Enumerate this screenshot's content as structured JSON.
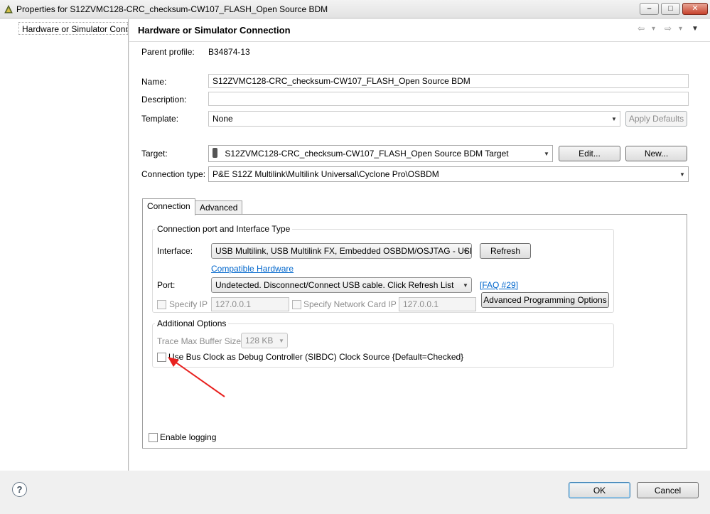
{
  "window": {
    "title": "Properties for S12ZVMC128-CRC_checksum-CW107_FLASH_Open Source BDM",
    "minimize_glyph": "–",
    "maximize_glyph": "□",
    "close_glyph": "✕"
  },
  "sidebar": {
    "items": [
      {
        "label": "Hardware or Simulator Conn"
      }
    ]
  },
  "page": {
    "title": "Hardware or Simulator Connection",
    "nav": {
      "back_glyph": "⇦",
      "back_menu": "▾",
      "forward_glyph": "⇨",
      "forward_menu": "▾",
      "view_menu": "▼"
    },
    "parent_profile_label": "Parent profile:",
    "parent_profile_value": "B34874-13",
    "name_label": "Name:",
    "name_value": "S12ZVMC128-CRC_checksum-CW107_FLASH_Open Source BDM",
    "description_label": "Description:",
    "description_value": "",
    "template_label": "Template:",
    "template_value": "None",
    "apply_defaults_label": "Apply Defaults",
    "target_label": "Target:",
    "target_value": "S12ZVMC128-CRC_checksum-CW107_FLASH_Open Source BDM Target",
    "edit_label": "Edit...",
    "new_label": "New...",
    "connection_type_label": "Connection type:",
    "connection_type_value": "P&E S12Z Multilink\\Multilink Universal\\Cyclone Pro\\OSBDM"
  },
  "tabs": [
    {
      "label": "Connection",
      "active": true
    },
    {
      "label": "Advanced",
      "active": false
    }
  ],
  "connection": {
    "group_title": "Connection port and Interface Type",
    "interface_label": "Interface:",
    "interface_value": "USB Multilink, USB Multilink FX, Embedded OSBDM/OSJTAG - USB",
    "refresh_label": "Refresh",
    "compatible_hardware_link": "Compatible Hardware",
    "port_label": "Port:",
    "port_value": "Undetected. Disconnect/Connect USB cable. Click Refresh List",
    "faq_link": "[FAQ #29]",
    "specify_ip_label": "Specify IP",
    "specify_ip_value": "127.0.0.1",
    "specify_network_card_label": "Specify Network Card IP",
    "network_card_value": "127.0.0.1",
    "advanced_programming_label": "Advanced Programming Options"
  },
  "additional": {
    "group_title": "Additional Options",
    "trace_buffer_label": "Trace Max Buffer Size:",
    "trace_buffer_value": "128 KB",
    "bus_clock_label": "Use Bus Clock as Debug Controller (SIBDC) Clock Source {Default=Checked}",
    "bus_clock_checked": false
  },
  "enable_logging_label": "Enable logging",
  "footer": {
    "help_glyph": "?",
    "ok_label": "OK",
    "cancel_label": "Cancel"
  },
  "colors": {
    "annotation_arrow": "#e8211f",
    "link": "#0066cc"
  }
}
